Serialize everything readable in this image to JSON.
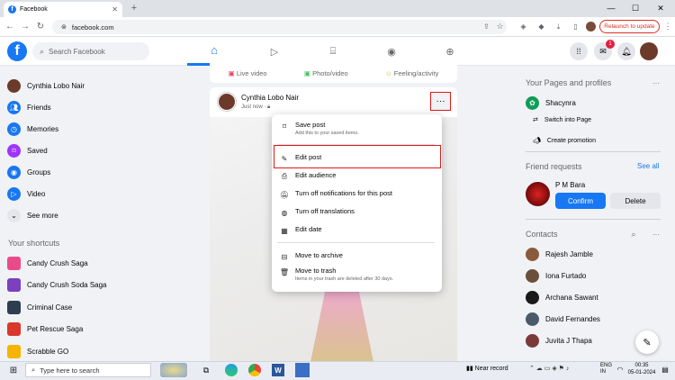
{
  "browser": {
    "tab_title": "Facebook",
    "url": "facebook.com",
    "relaunch_label": "Relaunch to update"
  },
  "header": {
    "logo": "f",
    "search_placeholder": "Search Facebook",
    "messenger_badge": "1"
  },
  "left_nav": {
    "items": [
      {
        "label": "Cynthia Lobo Nair",
        "icon": "avatar",
        "color": "#6b3a2a"
      },
      {
        "label": "Friends",
        "icon": "friends-icon",
        "color": "#1877f2"
      },
      {
        "label": "Memories",
        "icon": "clock-icon",
        "color": "#1877f2"
      },
      {
        "label": "Saved",
        "icon": "bookmark-icon",
        "color": "#a033ff"
      },
      {
        "label": "Groups",
        "icon": "groups-icon",
        "color": "#1877f2"
      },
      {
        "label": "Video",
        "icon": "video-icon",
        "color": "#1877f2"
      },
      {
        "label": "See more",
        "icon": "chevron-down-icon",
        "color": "#e4e6eb"
      }
    ],
    "shortcuts_heading": "Your shortcuts",
    "shortcuts": [
      {
        "label": "Candy Crush Saga",
        "color": "#e94b8a"
      },
      {
        "label": "Candy Crush Soda Saga",
        "color": "#7b3fbf"
      },
      {
        "label": "Criminal Case",
        "color": "#2c3e50"
      },
      {
        "label": "Pet Rescue Saga",
        "color": "#d9382b"
      },
      {
        "label": "Scrabble GO",
        "color": "#f4b400"
      }
    ]
  },
  "composer": {
    "live": "Live video",
    "photo": "Photo/video",
    "feeling": "Feeling/activity"
  },
  "post": {
    "author": "Cynthia Lobo Nair",
    "time": "Just now ·"
  },
  "menu": {
    "save_title": "Save post",
    "save_sub": "Add this to your saved items.",
    "edit": "Edit post",
    "audience": "Edit audience",
    "notifications": "Turn off notifications for this post",
    "translations": "Turn off translations",
    "date": "Edit date",
    "archive": "Move to archive",
    "trash_title": "Move to trash",
    "trash_sub": "Items in your trash are deleted after 30 days."
  },
  "right": {
    "pages_heading": "Your Pages and profiles",
    "page_name": "Shacynra",
    "switch": "Switch into Page",
    "promote": "Create promotion",
    "requests_heading": "Friend requests",
    "see_all": "See all",
    "requester": "P M Bara",
    "confirm": "Confirm",
    "delete": "Delete",
    "contacts_heading": "Contacts",
    "contacts": [
      {
        "name": "Rajesh Jamble",
        "color": "#8a5a3c"
      },
      {
        "name": "Iona Furtado",
        "color": "#6b4f3a"
      },
      {
        "name": "Archana Sawant",
        "color": "#1a1a1a"
      },
      {
        "name": "David Fernandes",
        "color": "#4a5a6a"
      },
      {
        "name": "Juvita J Thapa",
        "color": "#7a3a3a"
      }
    ]
  },
  "taskbar": {
    "search": "Type here to search",
    "weather": "Near record",
    "lang": "ENG\nIN",
    "time": "00:35",
    "date": "05-01-2024"
  }
}
